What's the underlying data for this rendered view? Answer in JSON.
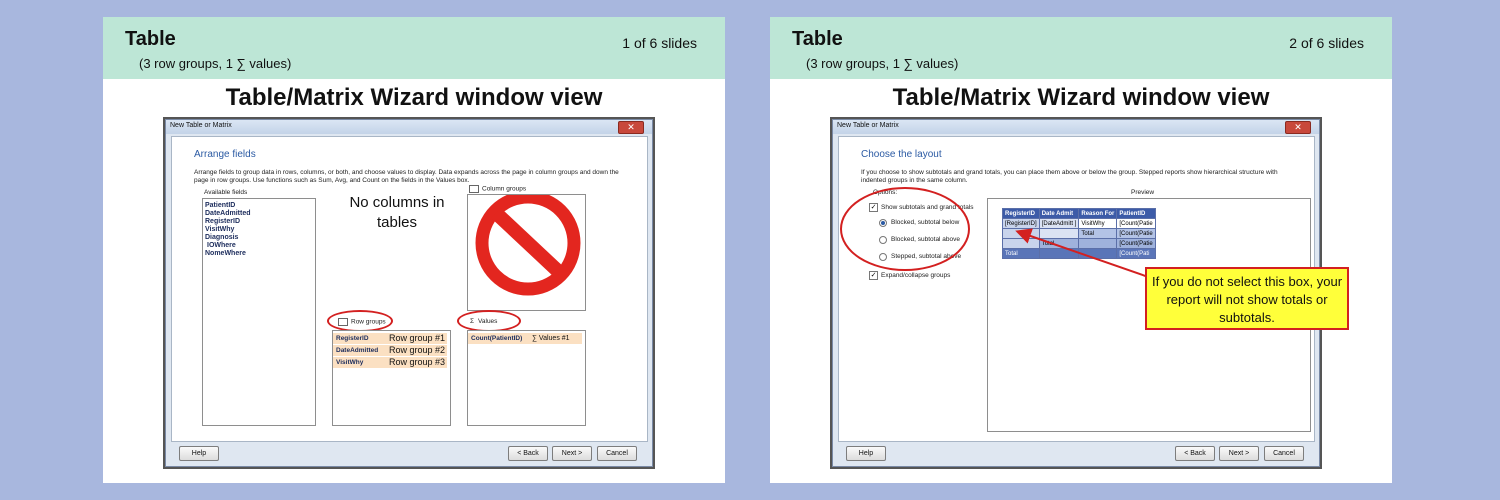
{
  "slides": [
    {
      "title": "Table",
      "subtitle": "(3 row groups, 1 ∑ values)",
      "count": "1 of 6 slides",
      "heading": "Table/Matrix Wizard window view",
      "window": {
        "title": "New Table or Matrix",
        "close": "✕",
        "page_title": "Arrange fields",
        "description": "Arrange fields to group data in rows, columns, or both, and choose values to display. Data expands across the page in column groups and down the page in row groups.  Use functions such as Sum, Avg, and Count on the fields in the Values box.",
        "available_label": "Available fields",
        "available_fields": [
          "PatientID",
          "DateAdmitted",
          "RegisterID",
          "VisitWhy",
          "Diagnosis",
          "IOWhere",
          "NomeWhere"
        ],
        "column_groups_label": "Column groups",
        "row_groups_label": "Row groups",
        "values_label": "Values",
        "row_groups": [
          {
            "field": "RegisterID",
            "note": "Row group #1"
          },
          {
            "field": "DateAdmitted",
            "note": "Row group #2"
          },
          {
            "field": "VisitWhy",
            "note": "Row group #3"
          }
        ],
        "values": [
          {
            "field": "Count(PatientID)",
            "note": "∑ Values #1"
          }
        ],
        "no_columns_note": "No columns in tables",
        "buttons": {
          "help": "Help",
          "back": "< Back",
          "next": "Next >",
          "cancel": "Cancel"
        }
      }
    },
    {
      "title": "Table",
      "subtitle": "(3 row groups, 1 ∑ values)",
      "count": "2 of 6 slides",
      "heading": "Table/Matrix Wizard window view",
      "window": {
        "title": "New Table or Matrix",
        "close": "✕",
        "page_title": "Choose the layout",
        "description": "If you choose to show subtotals and grand totals, you can place them above or below the group. Stepped reports show hierarchical structure with indented groups in the same column.",
        "options_label": "Options:",
        "preview_label": "Preview",
        "show_subtotals": "Show subtotals and grand totals",
        "radio_options": [
          "Blocked, subtotal below",
          "Blocked, subtotal above",
          "Stepped, subtotal above"
        ],
        "expand_collapse": "Expand/collapse groups",
        "preview_headers": [
          "RegisterID",
          "Date Admit",
          "Reason For",
          "PatientID"
        ],
        "preview_cells": {
          "r1": "[RegisterID]",
          "r1b": "[DateAdmitt ]",
          "r1c": "VisitWhy",
          "r1d": "[Count(Patie",
          "total": "Total",
          "count": "[Count(Patie",
          "count_last": "[Count(Pati"
        },
        "callout": "If you do not select this box, your report will not show totals or subtotals.",
        "buttons": {
          "help": "Help",
          "back": "< Back",
          "next": "Next >",
          "cancel": "Cancel"
        }
      }
    }
  ],
  "colors": {
    "background": "#a8b7de",
    "header": "#bde6d6",
    "callout_red": "#d32020",
    "note_yellow": "#ffff3a",
    "prohibition": "#e3261f"
  }
}
